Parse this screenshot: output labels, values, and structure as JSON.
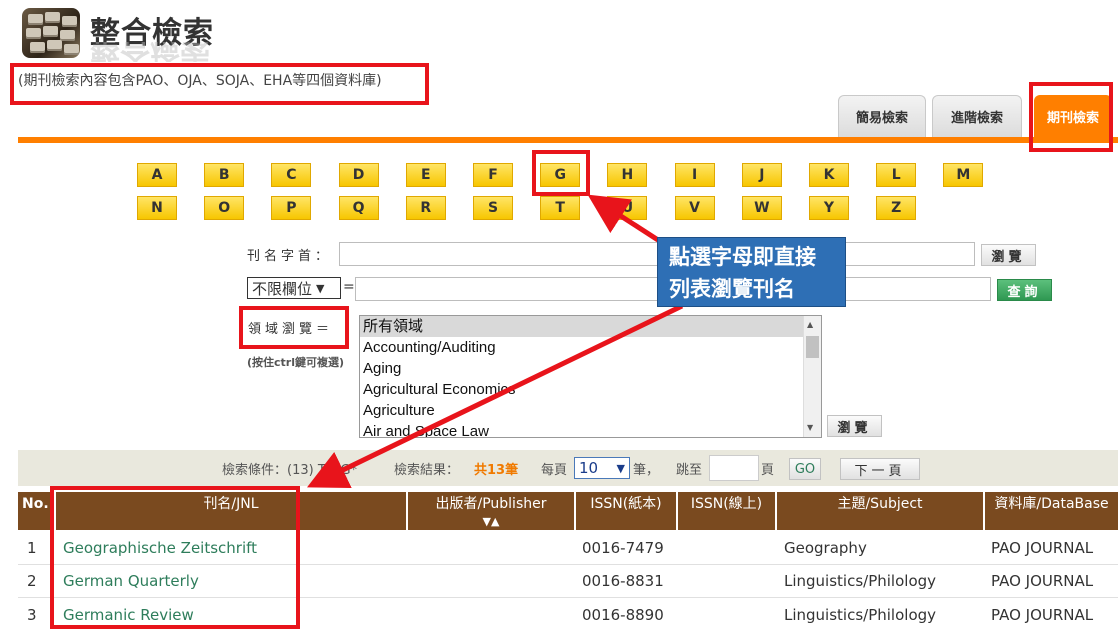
{
  "header": {
    "title": "整合檢索",
    "subtitle": "(期刊檢索內容包含PAO、OJA、SOJA、EHA等四個資料庫)"
  },
  "tabs": [
    {
      "label": "簡易檢索",
      "active": false
    },
    {
      "label": "進階檢索",
      "active": false
    },
    {
      "label": "期刊檢索",
      "active": true
    }
  ],
  "letters": {
    "row1": [
      "A",
      "B",
      "C",
      "D",
      "E",
      "F",
      "G",
      "H",
      "I",
      "J",
      "K",
      "L",
      "M"
    ],
    "row2": [
      "N",
      "O",
      "P",
      "Q",
      "R",
      "S",
      "T",
      "U",
      "V",
      "W",
      "Y",
      "Z"
    ],
    "selected": "G"
  },
  "form": {
    "title_initial_label": "刊名字首：",
    "browse_button": "瀏覽",
    "field_select": "不限欄位",
    "equals": "=",
    "search_button": "查詢",
    "domain_label": "領域瀏覽＝",
    "ctrl_hint": "(按住ctrl鍵可複選)",
    "domain_options": [
      "所有領域",
      "Accounting/Auditing",
      "Aging",
      "Agricultural Economics",
      "Agriculture",
      "Air and Space Law"
    ],
    "domain_browse_button": "瀏覽"
  },
  "criteria": {
    "label": "檢索條件：(13) TI=G*",
    "result_label": "檢索結果：",
    "result_count": "共13筆",
    "per_page_label": "每頁",
    "per_page_value": "10",
    "per_page_unit": "筆，",
    "goto_label": "跳至",
    "page_unit": "頁",
    "go_button": "GO",
    "next_button": "下一頁"
  },
  "table": {
    "headers": {
      "no": "No.",
      "jnl": "刊名/JNL",
      "publisher": "出版者/Publisher",
      "sort_arrows": "▼▲",
      "issn_print": "ISSN(紙本)",
      "issn_online": "ISSN(線上)",
      "subject": "主題/Subject",
      "database": "資料庫/DataBase"
    },
    "rows": [
      {
        "no": "1",
        "jnl": "Geographische Zeitschrift",
        "publisher": "",
        "issn_print": "0016-7479",
        "issn_online": "",
        "subject": "Geography",
        "database": "PAO JOURNAL"
      },
      {
        "no": "2",
        "jnl": "German Quarterly",
        "publisher": "",
        "issn_print": "0016-8831",
        "issn_online": "",
        "subject": "Linguistics/Philology",
        "database": "PAO JOURNAL"
      },
      {
        "no": "3",
        "jnl": "Germanic Review",
        "publisher": "",
        "issn_print": "0016-8890",
        "issn_online": "",
        "subject": "Linguistics/Philology",
        "database": "PAO JOURNAL"
      }
    ]
  },
  "annotation": {
    "callout_line1": "點選字母即直接",
    "callout_line2": "列表瀏覽刊名",
    "highlight_color": "#e8141b",
    "callout_color": "#2e6fb5"
  },
  "colors": {
    "accent_orange": "#ff7f00",
    "table_header": "#7a4a1f",
    "letter_yellow": "#f7c600",
    "link_green": "#2e7d5b"
  }
}
